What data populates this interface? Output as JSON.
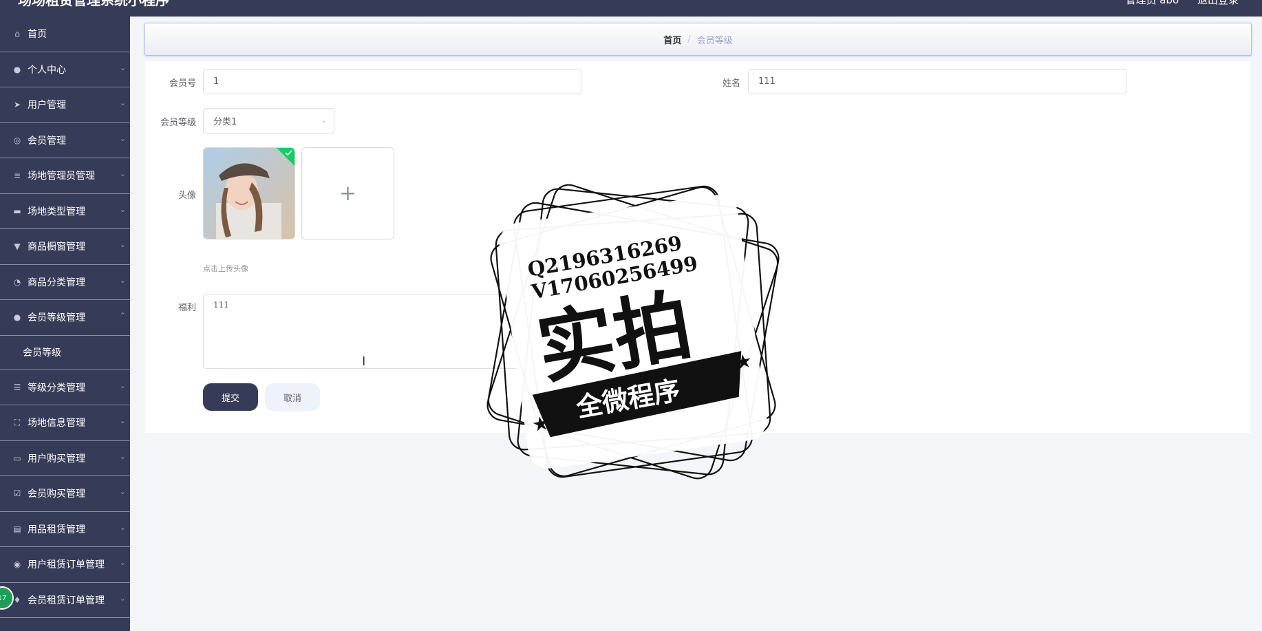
{
  "app": {
    "title": "场场租赁管理系统小程序"
  },
  "header": {
    "user_label": "管理员 abo",
    "logout_label": "退出登录"
  },
  "sidebar": {
    "items": [
      {
        "label": "首页",
        "icon": "home-icon",
        "glyph": "⌂",
        "has_arrow": false
      },
      {
        "label": "个人中心",
        "icon": "user-icon",
        "glyph": "●",
        "has_arrow": true
      },
      {
        "label": "用户管理",
        "icon": "send-icon",
        "glyph": "➤",
        "has_arrow": true
      },
      {
        "label": "会员管理",
        "icon": "target-icon",
        "glyph": "◎",
        "has_arrow": true
      },
      {
        "label": "场地管理员管理",
        "icon": "menu-lines-icon",
        "glyph": "≡",
        "has_arrow": true
      },
      {
        "label": "场地类型管理",
        "icon": "ticket-icon",
        "glyph": "▬",
        "has_arrow": true
      },
      {
        "label": "商品橱窗管理",
        "icon": "brush-icon",
        "glyph": "▼",
        "has_arrow": true
      },
      {
        "label": "商品分类管理",
        "icon": "gauge-icon",
        "glyph": "◔",
        "has_arrow": true
      },
      {
        "label": "会员等级管理",
        "icon": "user-icon",
        "glyph": "●",
        "has_arrow": true,
        "expanded": true
      },
      {
        "label": "会员等级",
        "submenu": true
      },
      {
        "label": "等级分类管理",
        "icon": "sliders-icon",
        "glyph": "☰",
        "has_arrow": true
      },
      {
        "label": "场地信息管理",
        "icon": "fullscreen-icon",
        "glyph": "⛶",
        "has_arrow": true
      },
      {
        "label": "用户购买管理",
        "icon": "chat-icon",
        "glyph": "▭",
        "has_arrow": true
      },
      {
        "label": "会员购买管理",
        "icon": "checkbox-icon",
        "glyph": "☑",
        "has_arrow": true
      },
      {
        "label": "用品租赁管理",
        "icon": "briefcase-icon",
        "glyph": "▤",
        "has_arrow": true
      },
      {
        "label": "用户租赁订单管理",
        "icon": "ring-icon",
        "glyph": "◉",
        "has_arrow": true
      },
      {
        "label": "会员租赁订单管理",
        "icon": "pin-icon",
        "glyph": "♦",
        "has_arrow": true
      }
    ]
  },
  "breadcrumb": {
    "home": "首页",
    "separator": "/",
    "current": "会员等级"
  },
  "form": {
    "member_no_label": "会员号",
    "member_no_value": "1",
    "name_label": "姓名",
    "name_value": "111",
    "level_label": "会员等级",
    "level_value": "分类1",
    "avatar_label": "头像",
    "upload_hint": "点击上传头像",
    "benefit_label": "福利",
    "benefit_value": "111",
    "submit_label": "提交",
    "cancel_label": "取消"
  },
  "watermark": {
    "qq": "Q2196316269",
    "wechat": "V17060256499",
    "main_text": "实拍",
    "ribbon_text": "全微程序"
  },
  "colors": {
    "sidebar_bg": "#363b57",
    "page_bg": "#f4f5f9",
    "accent": "#363b57"
  }
}
